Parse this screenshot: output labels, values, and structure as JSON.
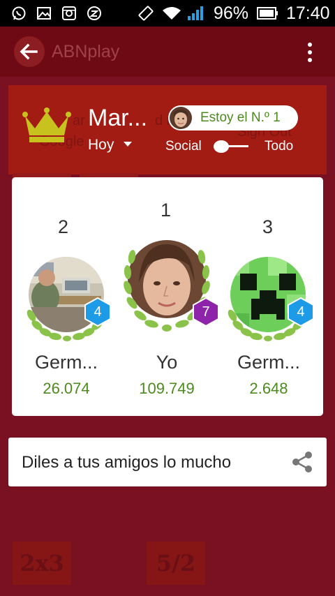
{
  "status_bar": {
    "battery_percent": "96%",
    "time": "17:40",
    "icons": [
      "whatsapp-icon",
      "gallery-icon",
      "instagram-icon",
      "no-disturb-icon",
      "rotate-icon",
      "wifi-icon",
      "signal-icon",
      "battery-icon"
    ]
  },
  "app_bar": {
    "title": "ABNplay",
    "back_icon": "arrow-back-icon",
    "menu_icon": "more-vert-icon"
  },
  "background": {
    "ghost_text_1": "ar",
    "ghost_text_2": "d in",
    "ghost_text_3": "Google",
    "ghost_text_4": "Sign Out",
    "tile_1": "2x3",
    "tile_2": "5/2"
  },
  "header": {
    "user_name": "Mar...",
    "period": "Hoy",
    "rank_pill": "Estoy el N.º 1",
    "toggle_left": "Social",
    "toggle_right": "Todo",
    "crown_color": "#c8c21e"
  },
  "podium": [
    {
      "rank": "2",
      "name": "Germ...",
      "score": "26.074",
      "level": "4",
      "badge_color": "#1e9be6"
    },
    {
      "rank": "1",
      "name": "Yo",
      "score": "109.749",
      "level": "7",
      "badge_color": "#8e24aa"
    },
    {
      "rank": "3",
      "name": "Germ...",
      "score": "2.648",
      "level": "4",
      "badge_color": "#1e9be6"
    }
  ],
  "share": {
    "text": "Diles a tus amigos lo mucho",
    "icon": "share-icon"
  },
  "colors": {
    "accent_green": "#4c8a1e",
    "background": "#7a1123",
    "laurel_green": "#8bc34a"
  }
}
